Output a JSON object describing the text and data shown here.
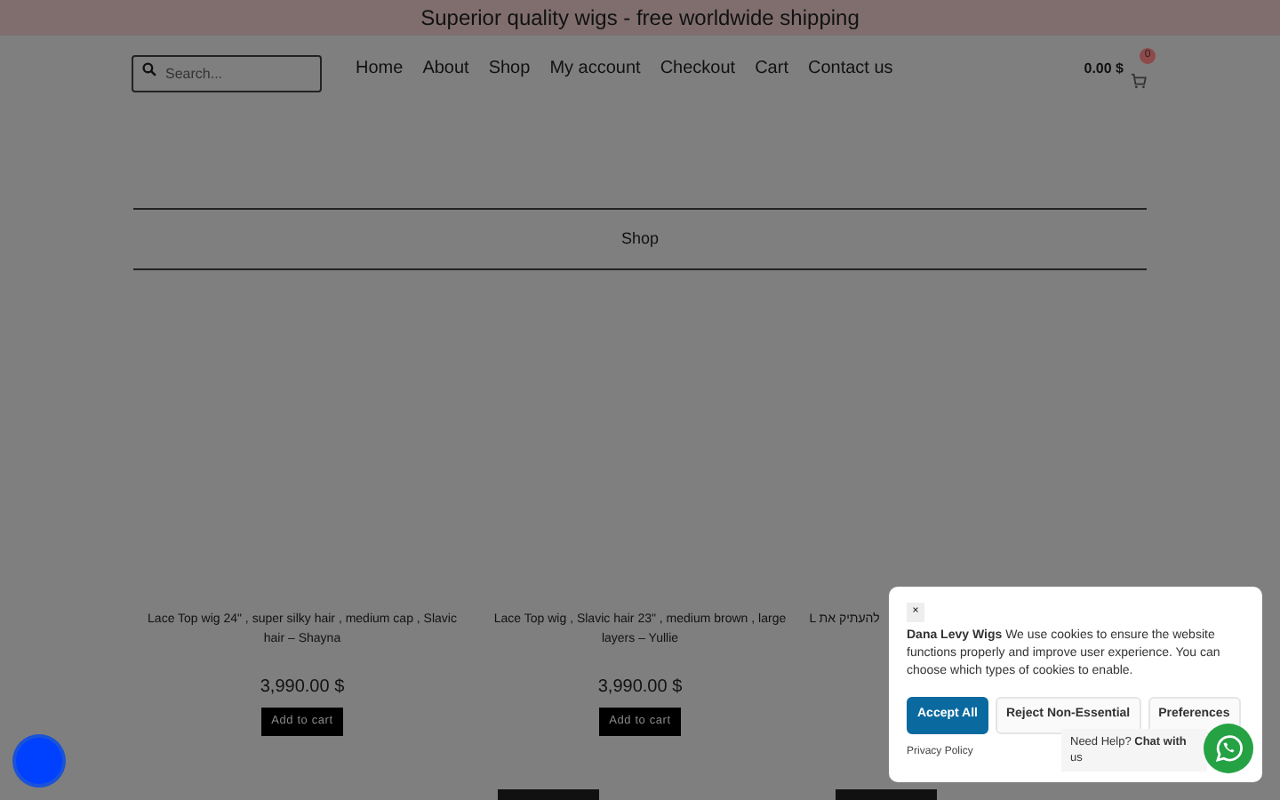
{
  "announcement": "Superior quality wigs - free worldwide shipping",
  "search": {
    "placeholder": "Search..."
  },
  "nav": [
    "Home",
    "About",
    "Shop",
    "My account",
    "Checkout",
    "Cart",
    "Contact us"
  ],
  "cart": {
    "total": "0.00 $",
    "count": "0"
  },
  "page_title": "Shop",
  "products": [
    {
      "title": "Lace Top wig 24\" , super silky hair , medium cap , Slavic hair – Shayna",
      "price": "3,990.00 $",
      "button": "Add to cart"
    },
    {
      "title": "Lace Top wig , Slavic hair 23\" , medium brown , large layers – Yullie",
      "price": "3,990.00 $",
      "button": "Add to cart"
    },
    {
      "title": "L להעתיק את"
    }
  ],
  "next_row": [
    {
      "kind": "button"
    },
    {
      "kind": "button"
    }
  ],
  "cookie": {
    "close": "×",
    "brand": "Dana Levy Wigs",
    "message": "We use cookies to ensure the website functions properly and improve user experience. You can choose which types of cookies to enable.",
    "buttons": [
      {
        "label": "Accept All",
        "kind": "primary"
      },
      {
        "label": "Reject Non-Essential",
        "kind": "secondary"
      },
      {
        "label": "Preferences",
        "kind": "secondary"
      }
    ],
    "privacy": "Privacy Policy"
  },
  "chat": {
    "text": "Need Help? **Chat with** us"
  }
}
